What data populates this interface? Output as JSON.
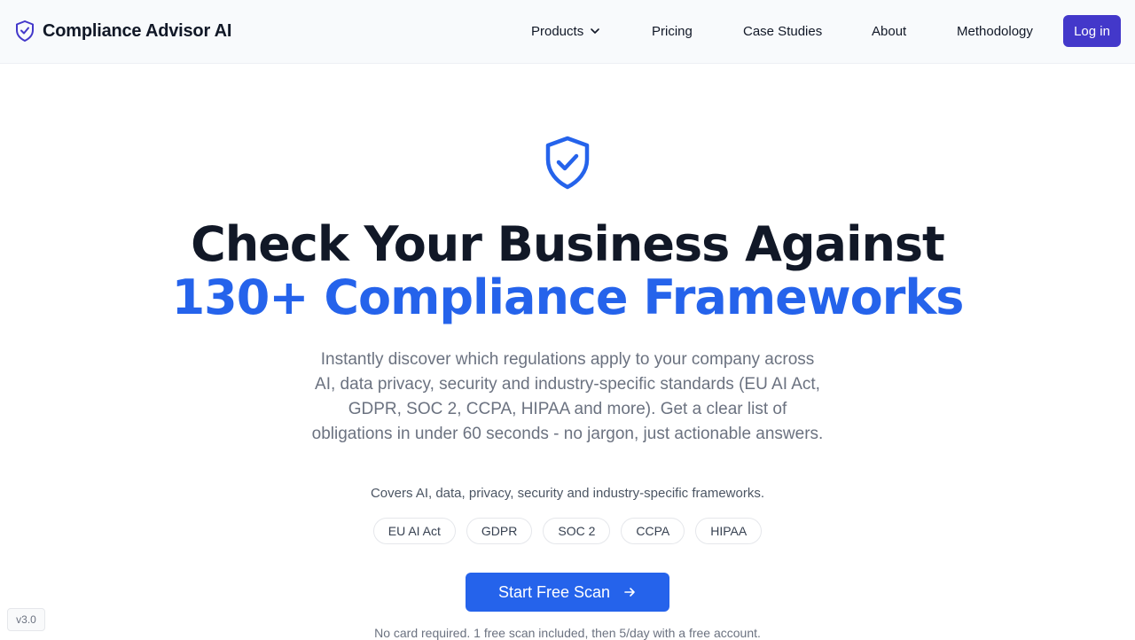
{
  "header": {
    "brand_name": "Compliance Advisor AI",
    "brand_icon": "shield-check-icon",
    "nav": {
      "products": "Products",
      "pricing": "Pricing",
      "case_studies": "Case Studies",
      "about": "About",
      "methodology": "Methodology"
    },
    "login_label": "Log in"
  },
  "hero": {
    "icon": "shield-check-icon",
    "headline_line1": "Check Your Business Against",
    "headline_line2": "130+ Compliance Frameworks",
    "subtitle": "Instantly discover which regulations apply to your company across AI, data privacy, security and industry-specific standards (EU AI Act, GDPR, SOC 2, CCPA, HIPAA and more). Get a clear list of obligations in under 60 seconds - no jargon, just actionable answers.",
    "covers_text": "Covers AI, data, privacy, security and industry-specific frameworks.",
    "frameworks": [
      "EU AI Act",
      "GDPR",
      "SOC 2",
      "CCPA",
      "HIPAA"
    ],
    "cta_label": "Start Free Scan",
    "cta_icon": "arrow-right-icon",
    "footnote": "No card required. 1 free scan included, then 5/day with a free account."
  },
  "version": "v3.0",
  "colors": {
    "accent": "#2563eb",
    "login_button": "#4338ca",
    "heading": "#111827",
    "muted": "#6b7280"
  }
}
